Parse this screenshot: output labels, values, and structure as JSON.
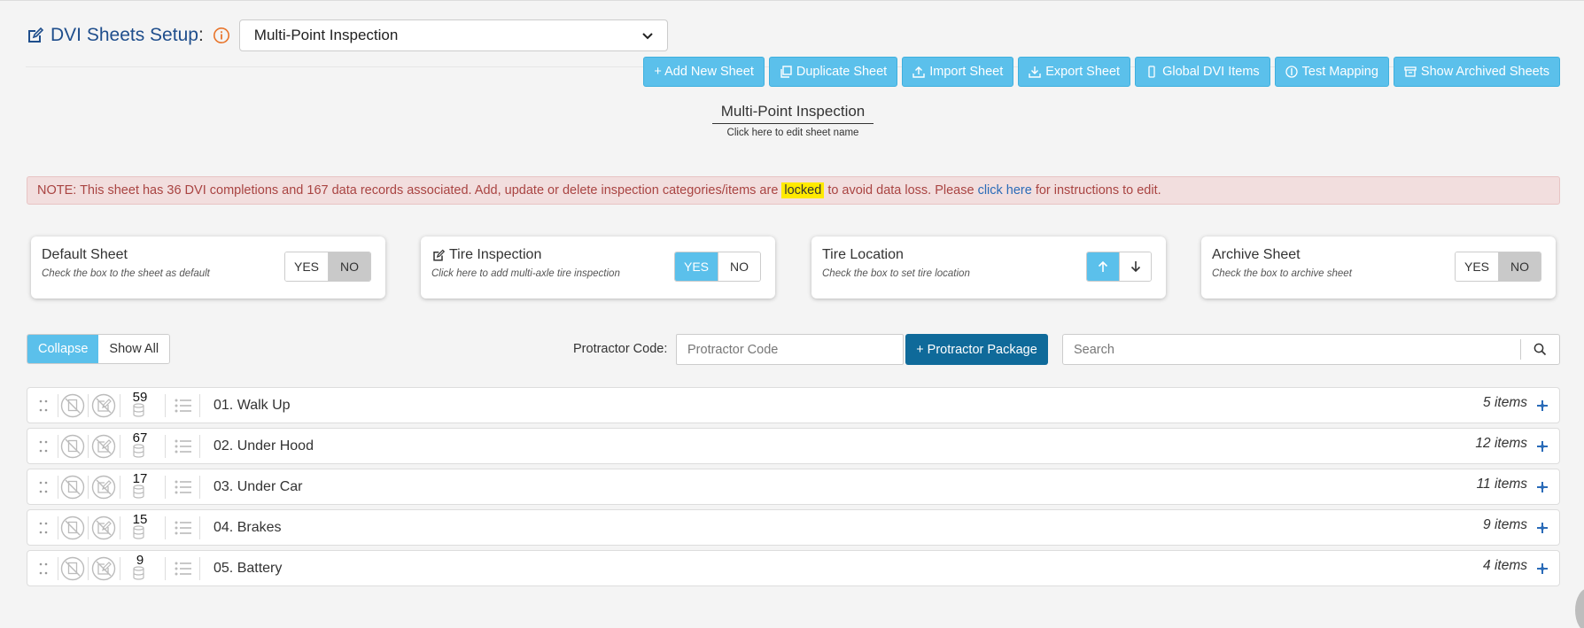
{
  "header": {
    "title": "DVI Sheets Setup",
    "title_colon": ":",
    "selected_sheet": "Multi-Point Inspection"
  },
  "toolbar": {
    "buttons": [
      {
        "label": "+ Add New Sheet",
        "icon": "plus-icon"
      },
      {
        "label": "Duplicate Sheet",
        "icon": "copy-icon"
      },
      {
        "label": "Import Sheet",
        "icon": "upload-icon"
      },
      {
        "label": "Export Sheet",
        "icon": "download-icon"
      },
      {
        "label": "Global DVI Items",
        "icon": "mobile-icon"
      },
      {
        "label": "Test Mapping",
        "icon": "info-icon"
      },
      {
        "label": "Show Archived Sheets",
        "icon": "archive-icon"
      }
    ]
  },
  "sheet": {
    "name": "Multi-Point Inspection",
    "hint": "Click here to edit sheet name"
  },
  "note": {
    "prefix": "NOTE: This sheet has 36 DVI completions and 167 data records associated. Add, update or delete inspection categories/items are",
    "locked": "locked",
    "middle": "to avoid data loss. Please",
    "link": "click here",
    "suffix": "for instructions to edit."
  },
  "cards": {
    "default_sheet": {
      "title": "Default Sheet",
      "sub": "Check the box to the sheet as default",
      "yes": "YES",
      "no": "NO",
      "value": "NO"
    },
    "tire_inspection": {
      "title": "Tire Inspection",
      "sub": "Click here to add multi-axle tire inspection",
      "yes": "YES",
      "no": "NO",
      "value": "YES"
    },
    "tire_location": {
      "title": "Tire Location",
      "sub": "Check the box to set tire location",
      "up": "↑",
      "down": "↓",
      "value": "up"
    },
    "archive_sheet": {
      "title": "Archive Sheet",
      "sub": "Check the box to archive sheet",
      "yes": "YES",
      "no": "NO",
      "value": "NO"
    }
  },
  "controls": {
    "collapse": "Collapse",
    "show_all": "Show All",
    "protractor_label": "Protractor Code:",
    "protractor_placeholder": "Protractor Code",
    "protractor_button": "+ Protractor Package",
    "search_placeholder": "Search"
  },
  "categories": [
    {
      "name": "01. Walk Up",
      "count": "59",
      "items": "5 items"
    },
    {
      "name": "02. Under Hood",
      "count": "67",
      "items": "12 items"
    },
    {
      "name": "03. Under Car",
      "count": "17",
      "items": "11 items"
    },
    {
      "name": "04. Brakes",
      "count": "15",
      "items": "9 items"
    },
    {
      "name": "05. Battery",
      "count": "9",
      "items": "4 items"
    }
  ],
  "colors": {
    "accent": "#5bc0eb",
    "dark_button": "#0f6a9a",
    "title": "#1f4e8c",
    "warning_bg": "#f2dede",
    "warning_text": "#a94442",
    "highlight": "#ffea00",
    "info_icon": "#e8742a"
  }
}
